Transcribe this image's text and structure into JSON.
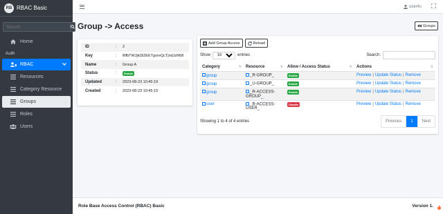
{
  "sidebar": {
    "brand_initials": "RB",
    "brand": "RBAC Basic",
    "search_placeholder": "Search",
    "home": "Home",
    "auth_header": "Auth",
    "rbac": "RBAC",
    "items": [
      "Resources",
      "Category Resource",
      "Groups",
      "Roles"
    ],
    "users": "Users"
  },
  "topbar": {
    "user": "user4c"
  },
  "page": {
    "title": "Group -> Access",
    "groups_button": "Groups"
  },
  "info": {
    "rows": [
      {
        "key": "ID",
        "value": "2"
      },
      {
        "key": "Key",
        "value": "MfbTWJjkt3i2EETgoreQcTjndJzN68"
      },
      {
        "key": "Name",
        "value": "Group A"
      },
      {
        "key": "Status",
        "badge": "Enable"
      },
      {
        "key": "Updated",
        "value": "2023-08-23 10:45:19"
      },
      {
        "key": "Created",
        "value": "2023-08-23 10:45:19"
      }
    ],
    "colon": ":"
  },
  "toolbar": {
    "add": "Add Group Access",
    "reload": "Reload"
  },
  "dt": {
    "show": "Show",
    "entries": "entries",
    "page_size": "10",
    "search_label": "Search:",
    "columns": [
      "Category",
      "Resource",
      "Allow / Access Status",
      "Actions"
    ],
    "rows": [
      {
        "category": "group",
        "resource": "_R-GROUP_",
        "status": "Enable"
      },
      {
        "category": "group",
        "resource": "_U-GROUP_",
        "status": "Enable"
      },
      {
        "category": "group",
        "resource": "_R-ACCESS-GROUP_",
        "status": "Enable"
      },
      {
        "category": "user",
        "resource": "_R-ACCESS-USER_",
        "status": "Disable"
      }
    ],
    "actions": {
      "preview": "Preview",
      "update": "Update Status",
      "remove": "Remove",
      "sep": "|"
    },
    "info_text": "Showing 1 to 4 of 4 entries",
    "prev": "Previous",
    "page": "1",
    "next": "Next"
  },
  "footer": {
    "text": "Role Base Access Control (RBAC) Basic",
    "version": "Version 1."
  },
  "colors": {
    "primary": "#007bff",
    "sidebar": "#343a40",
    "success": "#28a745",
    "danger": "#dc3545"
  }
}
